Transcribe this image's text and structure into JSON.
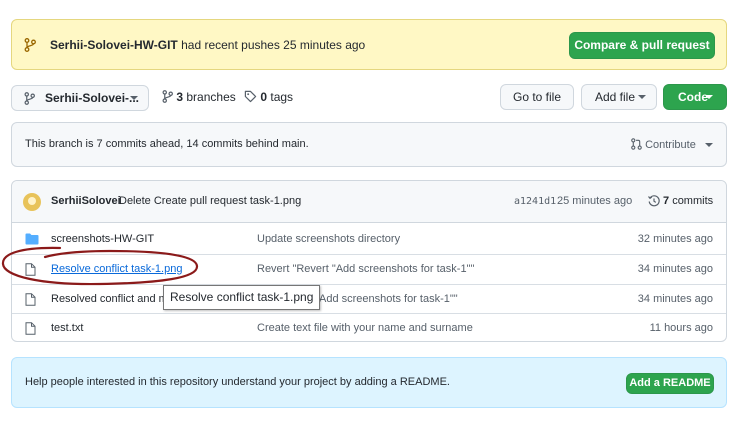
{
  "flash": {
    "branch_name": "Serhii-Solovei-HW-GIT",
    "message": "had recent pushes 25 minutes ago",
    "compare_label": "Compare & pull request"
  },
  "toolbar": {
    "branch_selector": "Serhii-Solovei-...",
    "branches_count": "3",
    "branches_label": "branches",
    "tags_count": "0",
    "tags_label": "tags",
    "goto_file": "Go to file",
    "add_file": "Add file",
    "code": "Code"
  },
  "ahead": {
    "text": "This branch is 7 commits ahead, 14 commits behind main.",
    "contribute": "Contribute"
  },
  "latest_commit": {
    "author": "SerhiiSolovei",
    "message": "Delete Create pull request task-1.png",
    "sha": "a1241d1",
    "time": "25 minutes ago",
    "count": "7",
    "count_label": "commits"
  },
  "files": [
    {
      "name": "screenshots-HW-GIT",
      "type": "folder",
      "commit": "Update screenshots directory",
      "age": "32 minutes ago"
    },
    {
      "name": "Resolve conflict task-1.png",
      "type": "file",
      "commit": "Revert \"Revert \"Add screenshots for task-1\"\"",
      "age": "34 minutes ago"
    },
    {
      "name": "Resolved conflict and m",
      "type": "file",
      "commit": "t \"Add screenshots for task-1\"\"",
      "age": "34 minutes ago"
    },
    {
      "name": "test.txt",
      "type": "file",
      "commit": "Create text file with your name and surname",
      "age": "11 hours ago"
    }
  ],
  "tooltip": "Resolve conflict task-1.png",
  "readme": {
    "text": "Help people interested in this repository understand your project by adding a README.",
    "button": "Add a README"
  },
  "colors": {
    "green": "#2da44e",
    "flash_bg": "#fff8c5",
    "link": "#0969da",
    "annotation": "#8b1a1a",
    "readme_bg": "#ddf4ff"
  }
}
